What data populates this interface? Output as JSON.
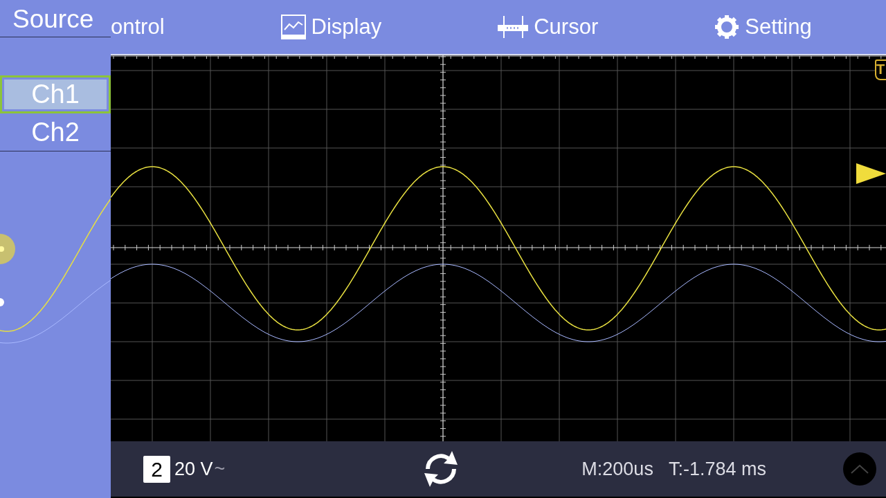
{
  "source_panel": {
    "title": "Source",
    "channels": [
      {
        "label": "Ch1",
        "selected": true
      },
      {
        "label": "Ch2",
        "selected": false
      }
    ]
  },
  "tabs": [
    {
      "label": "ontrol",
      "kind": "plain"
    },
    {
      "label": "Display",
      "kind": "chart"
    },
    {
      "label": "Cursor",
      "kind": "ruler"
    },
    {
      "label": "Setting",
      "kind": "gear"
    }
  ],
  "trigger_marker": "T",
  "status_bar": {
    "channel": "2",
    "scale": "20 V",
    "coupling": "~",
    "timebase": "M:200us",
    "trigger_offset": "T:-1.784 ms"
  }
}
